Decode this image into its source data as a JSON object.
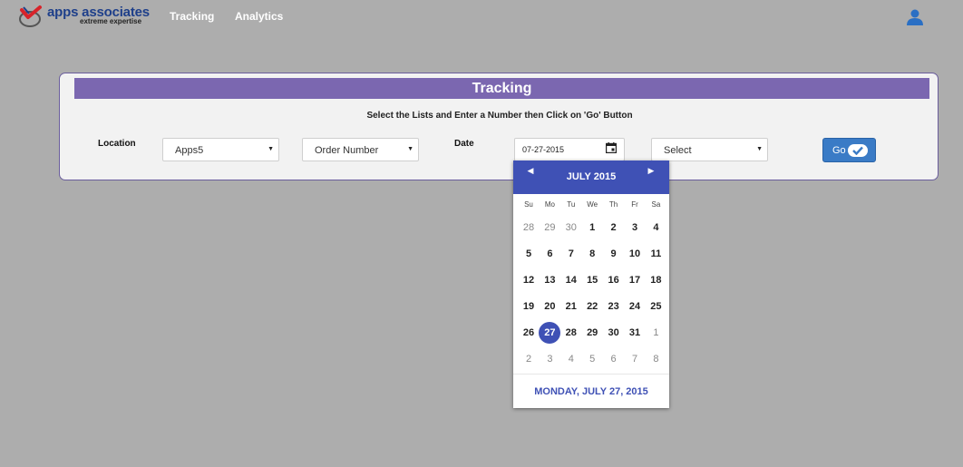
{
  "nav": {
    "brand": "apps associates",
    "tagline": "extreme expertise",
    "links": [
      {
        "label": "Tracking"
      },
      {
        "label": "Analytics"
      }
    ],
    "user_icon": "user-icon"
  },
  "panel": {
    "title": "Tracking",
    "instructions": "Select the Lists and Enter a Number then Click on 'Go' Button",
    "location_label": "Location",
    "location_value": "Apps5",
    "type_value": "Order Number",
    "date_label": "Date",
    "date_value": "07-27-2015",
    "extra_value": "Select",
    "go_label": "Go"
  },
  "datepicker": {
    "month_title": "JULY 2015",
    "weekdays": [
      "Su",
      "Mo",
      "Tu",
      "We",
      "Th",
      "Fr",
      "Sa"
    ],
    "weeks": [
      [
        "28",
        "29",
        "30",
        "1",
        "2",
        "3",
        "4"
      ],
      [
        "5",
        "6",
        "7",
        "8",
        "9",
        "10",
        "11"
      ],
      [
        "12",
        "13",
        "14",
        "15",
        "16",
        "17",
        "18"
      ],
      [
        "19",
        "20",
        "21",
        "22",
        "23",
        "24",
        "25"
      ],
      [
        "26",
        "27",
        "28",
        "29",
        "30",
        "31",
        "1"
      ],
      [
        "2",
        "3",
        "4",
        "5",
        "6",
        "7",
        "8"
      ]
    ],
    "selected_day": "27",
    "footer": "MONDAY, JULY 27, 2015"
  },
  "colors": {
    "accent": "#3f51b5",
    "panel_header": "#7b67b0",
    "go_button": "#3a7bc6",
    "background": "#adadad"
  }
}
